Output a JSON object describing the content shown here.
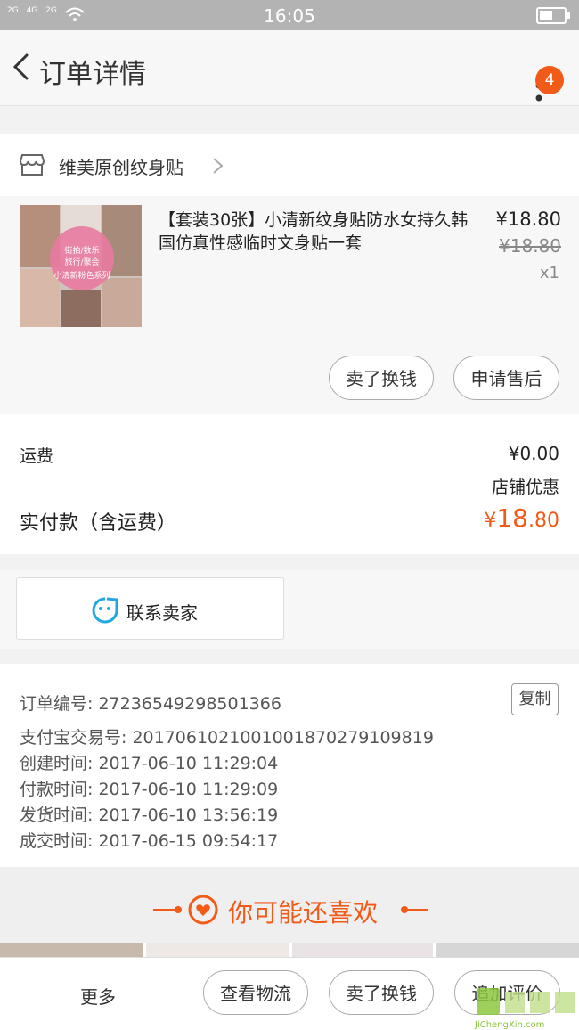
{
  "status_bar": {
    "signal_1": "2G",
    "signal_2": "4G",
    "signal_3": "2G",
    "time": "16:05"
  },
  "nav": {
    "title": "订单详情",
    "badge_count": "4"
  },
  "store": {
    "name": "维美原创纹身贴"
  },
  "product": {
    "title": "【套装30张】小清新纹身贴防水女持久韩国仿真性感临时文身贴一套",
    "price": "¥18.80",
    "original_price": "¥18.80",
    "quantity": "x1",
    "thumb_caption_1": "街拍/数乐",
    "thumb_caption_2": "旅行/聚会",
    "thumb_caption_3": "小清新粉色系列",
    "sell_button": "卖了换钱",
    "aftersale_button": "申请售后"
  },
  "fees": {
    "shipping_label": "运费",
    "shipping_value": "¥0.00",
    "discount_label": "店铺优惠",
    "total_label": "实付款（含运费）",
    "total_currency": "¥",
    "total_integer": "18",
    "total_decimal": ".80"
  },
  "contact": {
    "label": "联系卖家"
  },
  "order_info": {
    "order_no": "订单编号: 27236549298501366",
    "copy_button": "复制",
    "alipay_no": "支付宝交易号: 2017061021001001870279109819",
    "created": "创建时间: 2017-06-10 11:29:04",
    "paid": "付款时间: 2017-06-10 11:29:09",
    "shipped": "发货时间: 2017-06-10 13:56:19",
    "completed": "成交时间: 2017-06-15 09:54:17"
  },
  "recommend": {
    "title": "你可能还喜欢"
  },
  "bottom_bar": {
    "more": "更多",
    "logistics": "查看物流",
    "sell": "卖了换钱",
    "review": "追加评价"
  },
  "watermark": {
    "text": "JiChengXin.com"
  },
  "colors": {
    "accent": "#f25a17",
    "watermark_green": "#8dc63f",
    "contact_icon": "#1fa8e0"
  }
}
